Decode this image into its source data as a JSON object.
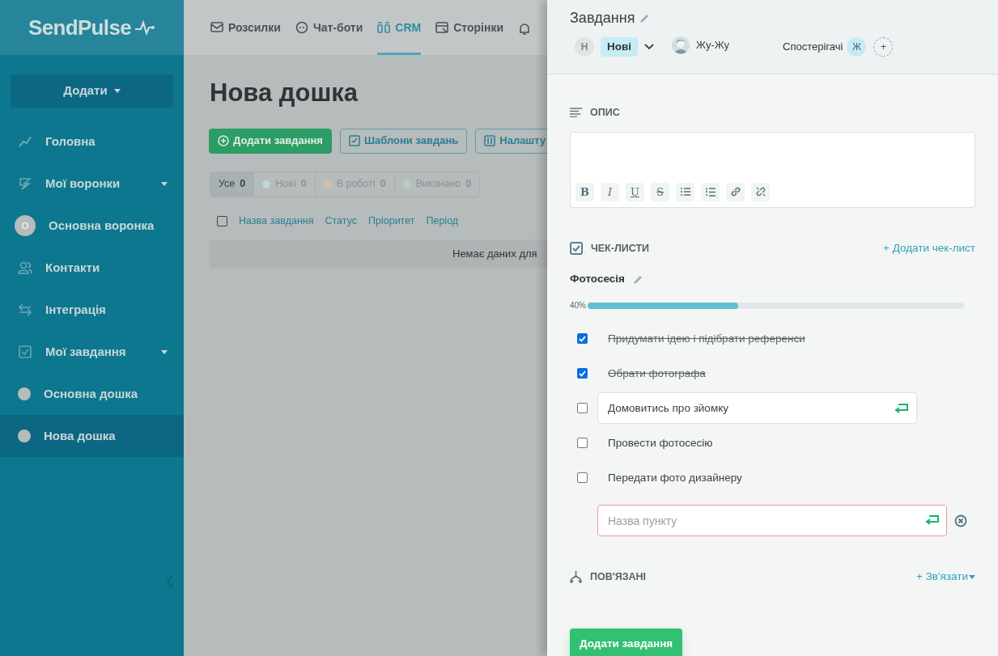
{
  "logo": {
    "text": "SendPulse"
  },
  "sidebar": {
    "add_button": "Додати",
    "items": [
      {
        "label": "Головна",
        "selected": false
      },
      {
        "label": "Мої воронки",
        "selected": false,
        "expandable": true
      },
      {
        "label": "Основна воронка",
        "avatar": "О",
        "selected": false
      },
      {
        "label": "Контакти",
        "selected": false
      },
      {
        "label": "Інтеграція",
        "selected": false
      },
      {
        "label": "Мої завдання",
        "selected": false,
        "expandable": true
      },
      {
        "label": "Основна дошка",
        "selected": false
      },
      {
        "label": "Нова дошка",
        "selected": true
      }
    ]
  },
  "top_nav": [
    {
      "label": "Розсилки",
      "selected": false
    },
    {
      "label": "Чат-боти",
      "selected": false
    },
    {
      "label": "CRM",
      "selected": true
    },
    {
      "label": "Сторінки",
      "selected": false
    }
  ],
  "page": {
    "title": "Нова дошка",
    "buttons": [
      {
        "label": "Додати завдання",
        "kind": "primary"
      },
      {
        "label": "Шаблони завдань",
        "kind": "templates"
      },
      {
        "label": "Налашту",
        "kind": "settings"
      }
    ],
    "filters": [
      {
        "label": "Усе",
        "count": "0",
        "selected": true
      },
      {
        "label": "Нові",
        "count": "0",
        "selected": false,
        "color": "#bcd6dc"
      },
      {
        "label": "В роботі",
        "count": "0",
        "selected": false,
        "color": "#cdc3a8"
      },
      {
        "label": "Виконано",
        "count": "0",
        "selected": false,
        "color": "#b9cdc4"
      }
    ],
    "table": {
      "checked": false,
      "columns": [
        "Назва завдання",
        "Статус",
        "Пріоритет",
        "Період"
      ],
      "empty_text": "Немає даних для"
    }
  },
  "panel": {
    "title": "Завдання",
    "status": {
      "avatar": "Н",
      "label": "Нові"
    },
    "assignee": {
      "name": "Жу-Жу"
    },
    "watchers": {
      "label": "Спостерігачі",
      "avatars": [
        "Ж"
      ],
      "add": "+"
    },
    "description": {
      "heading": "ОПИС",
      "toolbar": [
        "B",
        "I",
        "U",
        "S"
      ]
    },
    "checklists": {
      "heading": "ЧЕК-ЛИСТИ",
      "add_link": "+ Додати чек-лист",
      "list": {
        "name": "Фотосесія",
        "progress_text": "40%",
        "level": 0.4,
        "items": [
          {
            "text": "Придумати ідею і підібрати референси",
            "checked": true,
            "kind": "text"
          },
          {
            "text": "Обрати фотографа",
            "checked": true,
            "kind": "text"
          },
          {
            "text": "Домовитись про зйомку",
            "checked": false,
            "kind": "editing"
          },
          {
            "text": "Провести фотосесію",
            "checked": false,
            "kind": "text"
          },
          {
            "text": "Передати фото дизайнеру",
            "checked": false,
            "kind": "text"
          }
        ],
        "new_item": {
          "placeholder": "Назва пункту"
        }
      }
    },
    "related": {
      "heading": "ПОВ'ЯЗАНІ",
      "link": "+ Зв'язати"
    },
    "submit": "Додати завдання"
  }
}
